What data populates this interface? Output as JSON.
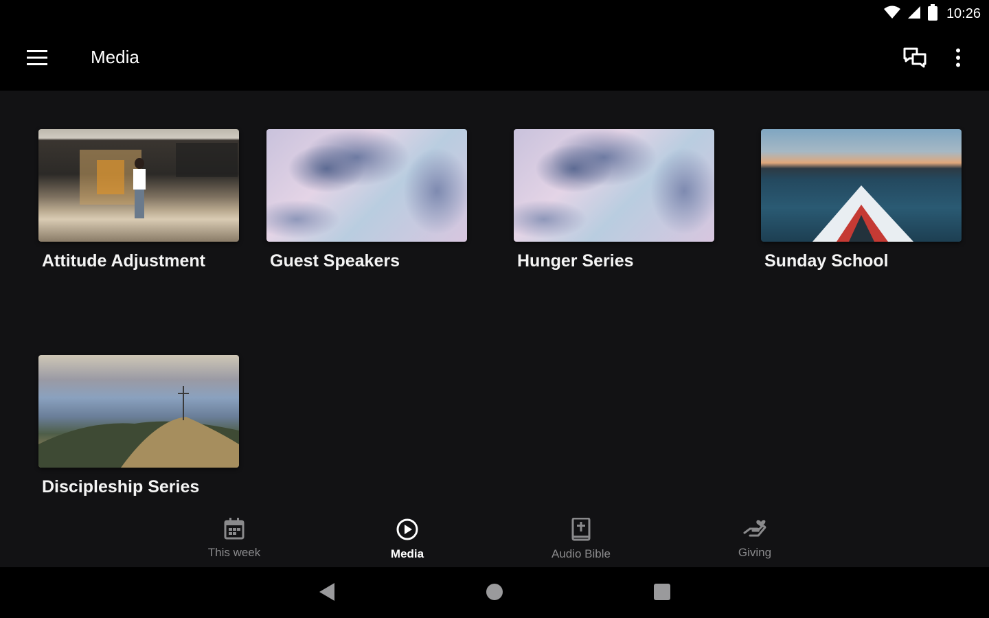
{
  "status_bar": {
    "time": "10:26",
    "icons": [
      "wifi-icon",
      "cellular-signal-icon",
      "battery-icon"
    ]
  },
  "app_bar": {
    "title": "Media",
    "icons": [
      "menu-icon",
      "chat-icon",
      "more-vertical-icon"
    ]
  },
  "media_items": [
    {
      "title": "Attitude Adjustment"
    },
    {
      "title": "Guest Speakers"
    },
    {
      "title": "Hunger Series"
    },
    {
      "title": "Sunday School"
    },
    {
      "title": "Discipleship Series"
    }
  ],
  "bottom_nav": {
    "items": [
      {
        "label": "This week",
        "icon": "calendar-icon",
        "active": false
      },
      {
        "label": "Media",
        "icon": "play-circle-icon",
        "active": true
      },
      {
        "label": "Audio Bible",
        "icon": "bible-icon",
        "active": false
      },
      {
        "label": "Giving",
        "icon": "giving-hand-icon",
        "active": false
      }
    ]
  },
  "system_nav": {
    "icons": [
      "back-icon",
      "home-icon",
      "recents-icon"
    ]
  },
  "colors": {
    "background": "#121214",
    "bar": "#000000",
    "nav_inactive": "#8a8a8c",
    "nav_active": "#ffffff"
  }
}
